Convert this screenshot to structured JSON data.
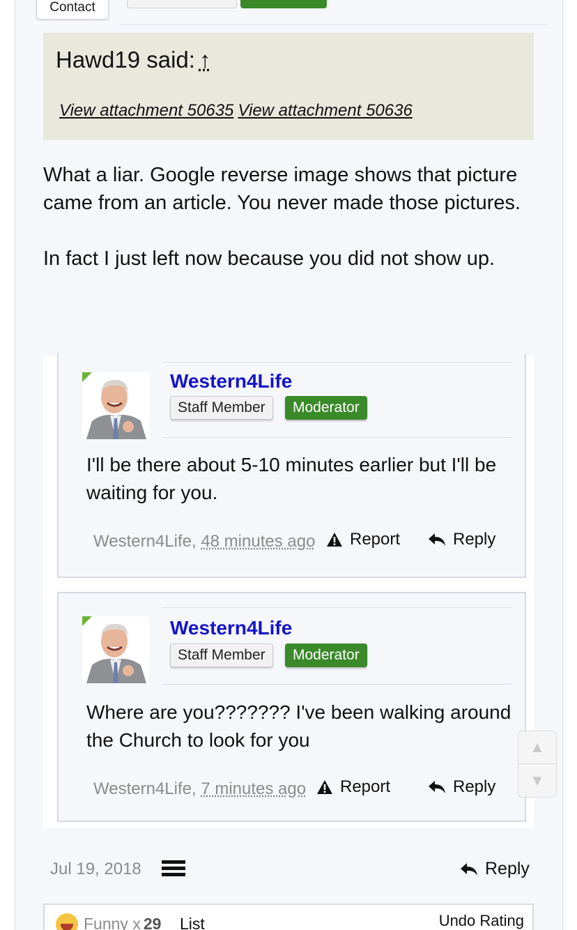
{
  "header": {
    "contact_tab": "Contact"
  },
  "quote": {
    "author_said": "Hawd19 said:",
    "arrow": "↑",
    "attachments": [
      "View attachment 50635",
      "View attachment 50636"
    ]
  },
  "post": {
    "body_p1": "What a liar. Google reverse image shows that picture came from an article. You never made those pictures.",
    "body_p2": "In fact I just left now because you did not show up.",
    "date": "Jul 19, 2018",
    "reply_label": "Reply"
  },
  "messages": [
    {
      "username": "Western4Life",
      "staff_badge": "Staff Member",
      "mod_badge": "Moderator",
      "text": "I'll be there about 5-10 minutes earlier but I'll be waiting for you.",
      "meta_user": "Western4Life,",
      "meta_time": "48 minutes ago",
      "report_label": "Report",
      "reply_label": "Reply"
    },
    {
      "username": "Western4Life",
      "staff_badge": "Staff Member",
      "mod_badge": "Moderator",
      "text": "Where are you??????? I've been walking around the Church to look for you",
      "meta_user": "Western4Life,",
      "meta_time": "7 minutes ago",
      "report_label": "Report",
      "reply_label": "Reply"
    }
  ],
  "rating": {
    "label": "Funny",
    "multiplier": "x",
    "count": "29",
    "list_label": "List",
    "undo_label": "Undo Rating"
  },
  "colors": {
    "username": "#1414c8",
    "moderator_badge": "#3a8a2a",
    "quote_bg": "#e8e8dd"
  }
}
